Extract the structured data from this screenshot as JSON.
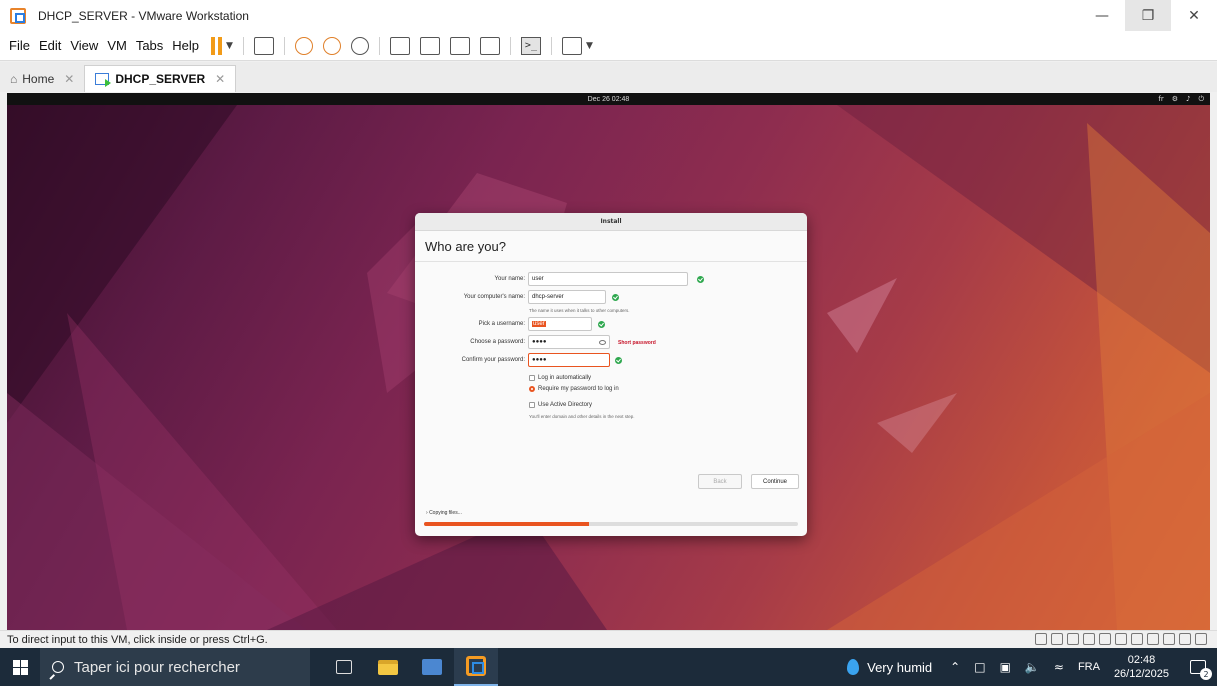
{
  "window": {
    "title": "DHCP_SERVER - VMware Workstation"
  },
  "menu": [
    "File",
    "Edit",
    "View",
    "VM",
    "Tabs",
    "Help"
  ],
  "tabs": [
    {
      "label": "Home",
      "active": false
    },
    {
      "label": "DHCP_SERVER",
      "active": true
    }
  ],
  "guest": {
    "topbar": {
      "clock": "Dec 26  02:48",
      "lang": "fr"
    },
    "installer": {
      "header": "Install",
      "title": "Who are you?",
      "name_label": "Your name:",
      "name_value": "user",
      "computer_label": "Your computer's name:",
      "computer_value": "dhcp-server",
      "computer_hint": "The name it uses when it talks to other computers.",
      "username_label": "Pick a username:",
      "username_value": "user",
      "password_label": "Choose a password:",
      "password_value": "●●●●",
      "password_strength": "Short password",
      "confirm_label": "Confirm your password:",
      "confirm_value": "●●●●",
      "opt_auto_login": "Log in automatically",
      "opt_require_password": "Require my password to log in",
      "opt_active_directory": "Use Active Directory",
      "ad_hint": "You'll enter domain and other details in the next step.",
      "back_label": "Back",
      "continue_label": "Continue",
      "copy_status": "Copying files...",
      "progress": 0.44,
      "accent": "#e95420"
    }
  },
  "status": {
    "text": "To direct input to this VM, click inside or press Ctrl+G."
  },
  "taskbar": {
    "search_placeholder": "Taper ici pour rechercher",
    "weather": "Very humid",
    "lang": "FRA",
    "time": "02:48",
    "date": "26/12/2025",
    "notifications": "2"
  }
}
